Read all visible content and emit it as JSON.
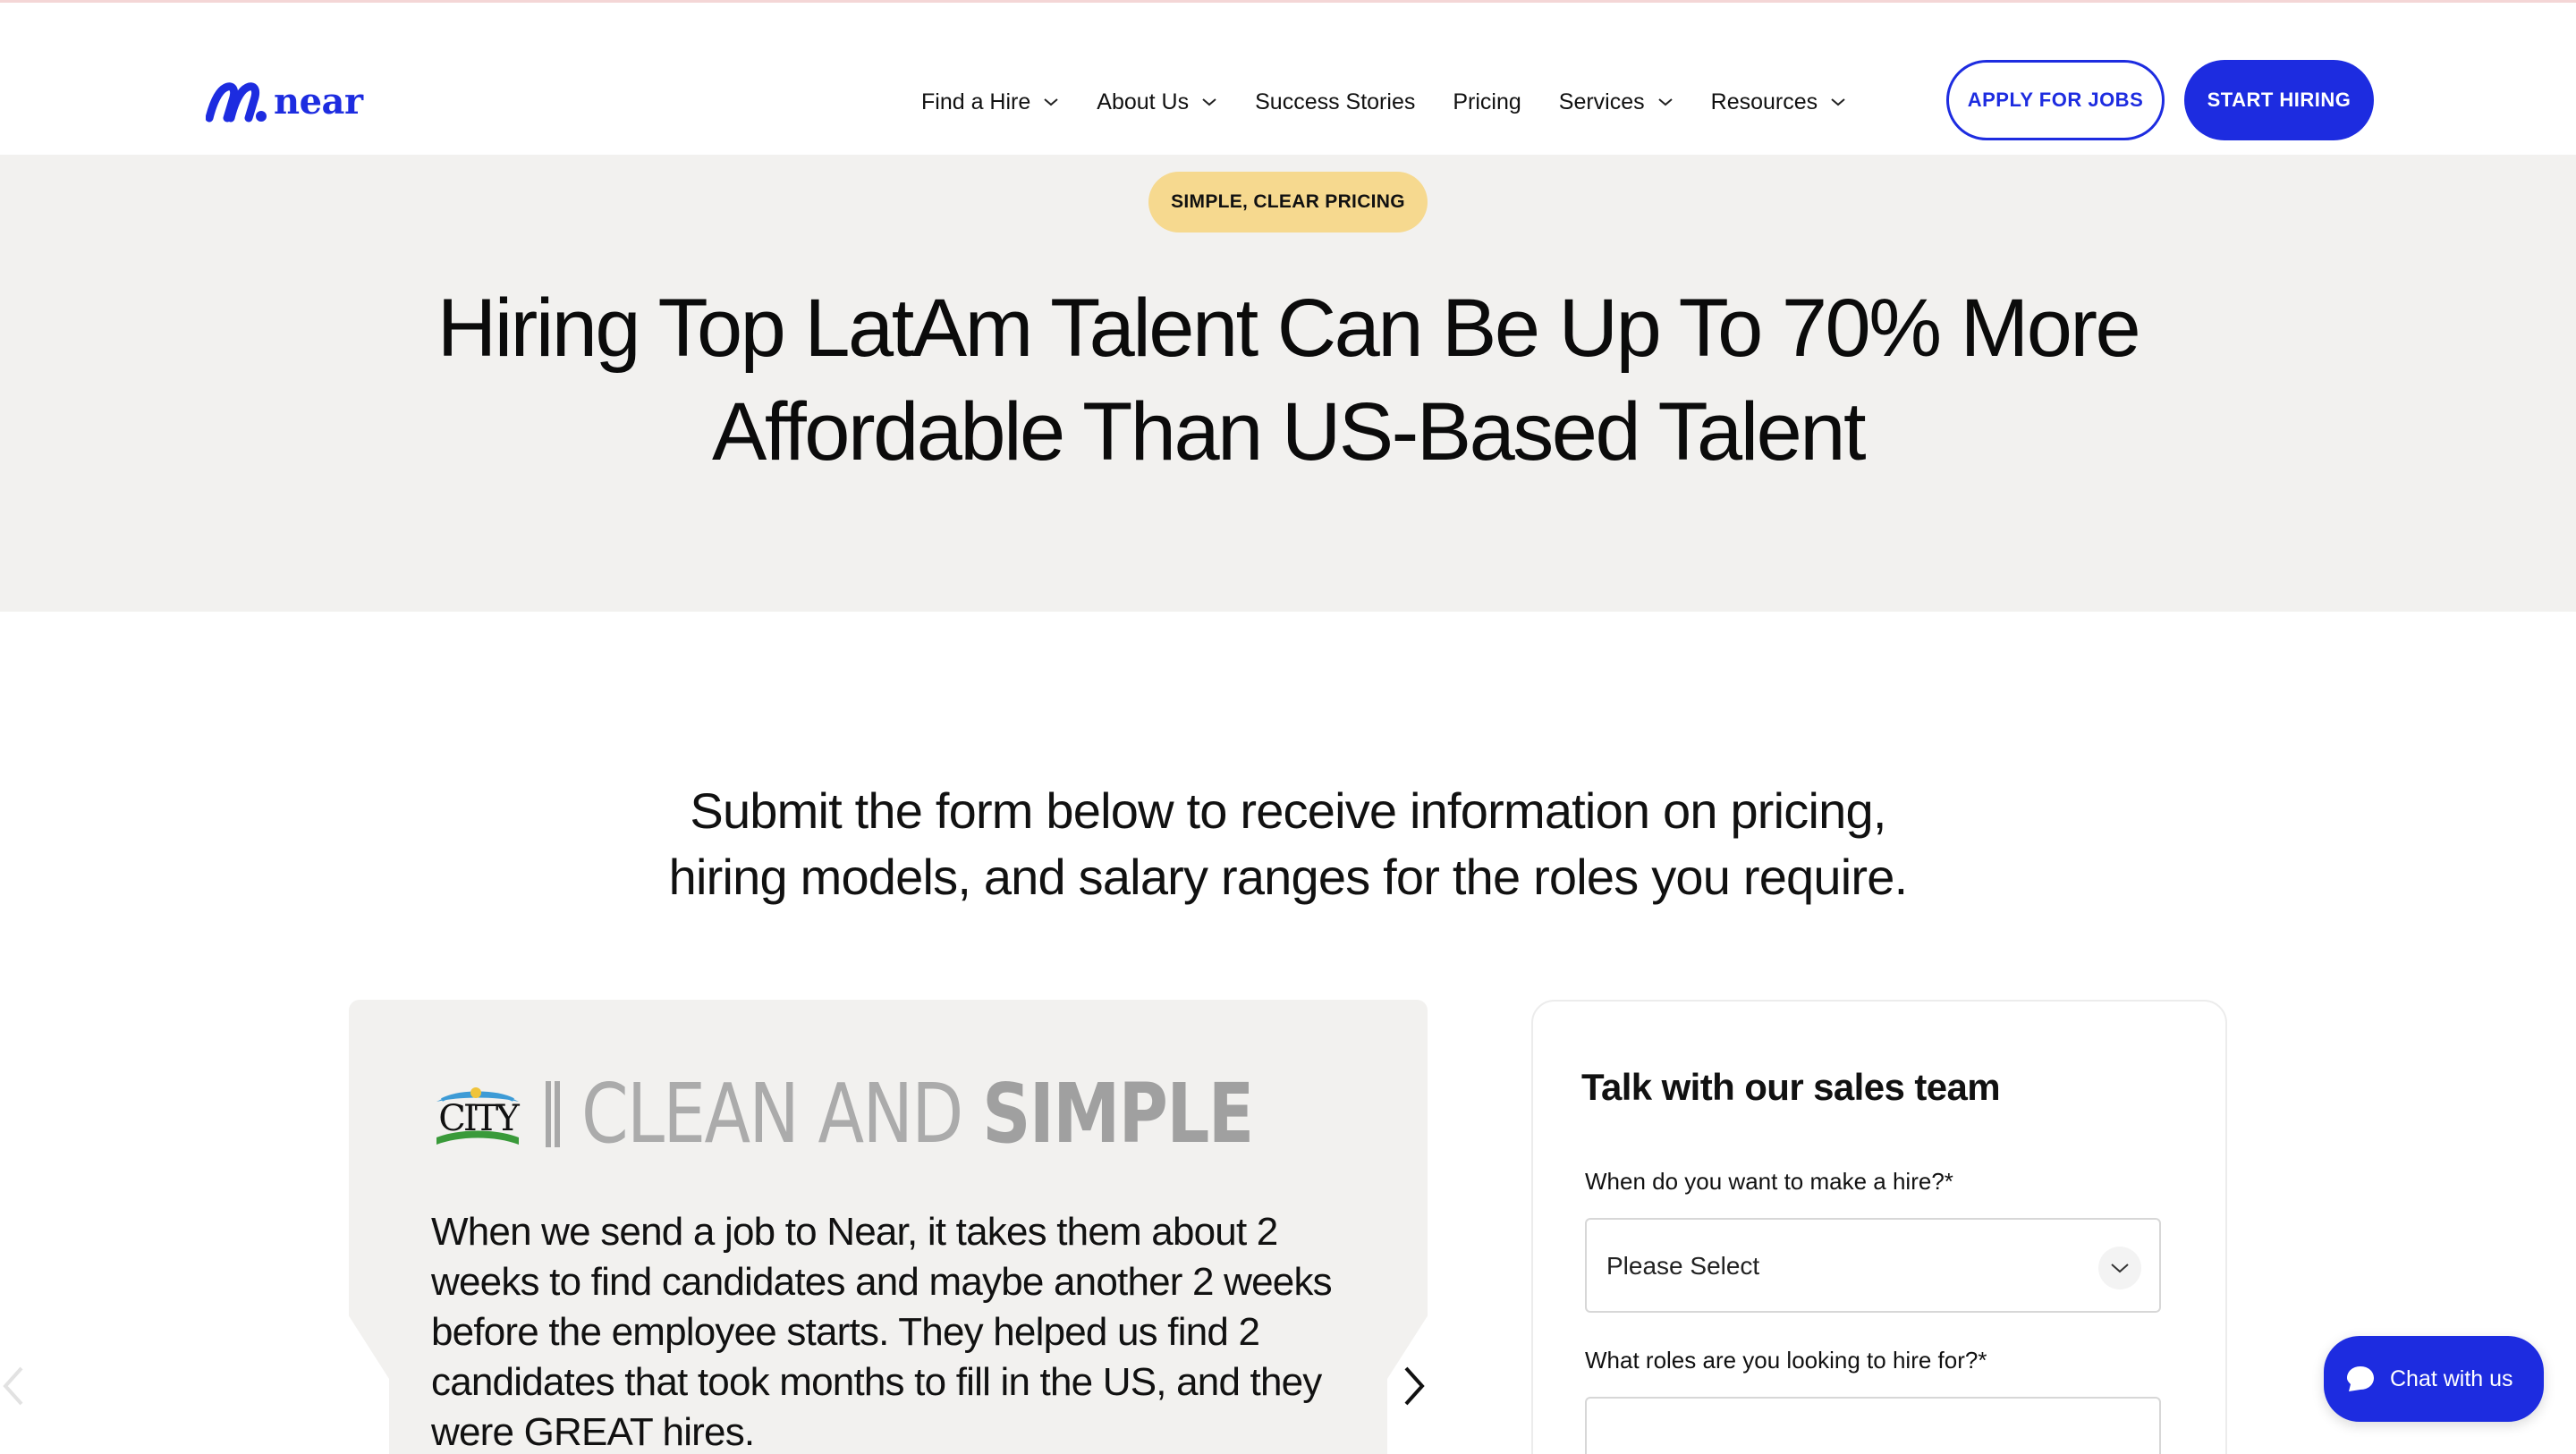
{
  "brand": {
    "name": "near",
    "color": "#1d2ce0"
  },
  "nav": {
    "items": [
      {
        "label": "Find a Hire",
        "dropdown": true
      },
      {
        "label": "About Us",
        "dropdown": true
      },
      {
        "label": "Success Stories",
        "dropdown": false
      },
      {
        "label": "Pricing",
        "dropdown": false
      },
      {
        "label": "Services",
        "dropdown": true
      },
      {
        "label": "Resources",
        "dropdown": true
      }
    ],
    "apply_label": "APPLY FOR JOBS",
    "start_label": "START HIRING"
  },
  "hero": {
    "badge": "SIMPLE, CLEAR PRICING",
    "title_line1": "Hiring Top LatAm Talent Can Be Up To 70% More",
    "title_line2": "Affordable Than US-Based Talent"
  },
  "intro": {
    "line1": "Submit the form below to receive information on pricing,",
    "line2": "hiring models, and salary ranges for the roles you require."
  },
  "testimonial": {
    "logo_small": "CITY",
    "brand_light": "CLEAN AND",
    "brand_bold": "SIMPLE",
    "quote": "When we send a job to Near, it takes them about 2 weeks to find candidates and maybe another 2 weeks before the employee starts. They helped us find 2 candidates that took months to fill in the US, and they were GREAT hires."
  },
  "form": {
    "title": "Talk with our sales team",
    "field1_label": "When do you want to make a hire?*",
    "field1_value": "Please Select",
    "field2_label": "What roles are you looking to hire for?*"
  },
  "chat": {
    "label": "Chat with us"
  },
  "colors": {
    "accent": "#1d2ce0",
    "hero_bg": "#f2f1ef",
    "badge_bg": "#f6d98f"
  }
}
